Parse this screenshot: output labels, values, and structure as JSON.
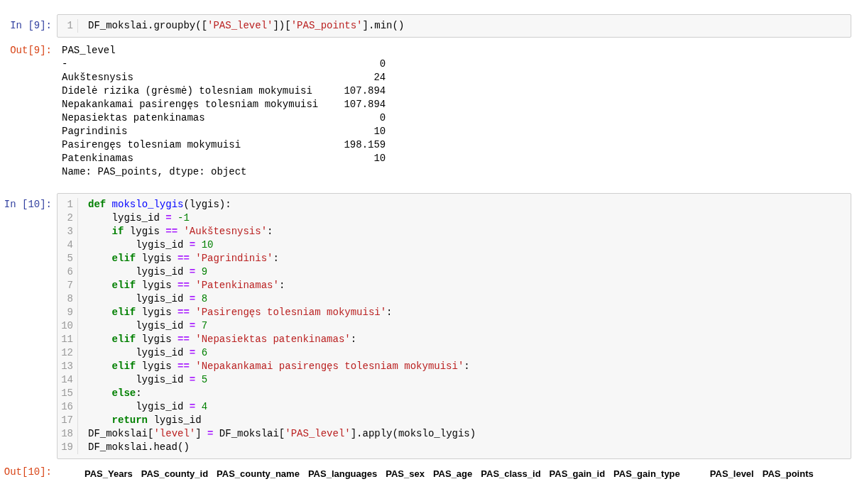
{
  "cells": [
    {
      "kind": "code",
      "prompt": "In [9]:",
      "line_numbers": [
        "1"
      ],
      "lines": [
        [
          {
            "plain": "DF_mokslai.groupby(["
          },
          {
            "str": "'PAS_level'"
          },
          {
            "plain": "])["
          },
          {
            "str": "'PAS_points'"
          },
          {
            "plain": "].min()"
          }
        ]
      ]
    },
    {
      "kind": "series",
      "prompt": "Out[9]:",
      "header": "PAS_level",
      "rows": [
        {
          "label": "-",
          "value": "0"
        },
        {
          "label": "Aukštesnysis",
          "value": "24"
        },
        {
          "label": "Didelė rizika (grėsmė) tolesniam mokymuisi",
          "value": "107.894"
        },
        {
          "label": "Nepakankamai pasirengęs tolesniam mokymuisi",
          "value": "107.894"
        },
        {
          "label": "Nepasiektas patenkinamas",
          "value": "0"
        },
        {
          "label": "Pagrindinis",
          "value": "10"
        },
        {
          "label": "Pasirengęs tolesniam mokymuisi",
          "value": "198.159"
        },
        {
          "label": "Patenkinamas",
          "value": "10"
        }
      ],
      "footer": "Name: PAS_points, dtype: object"
    },
    {
      "kind": "code",
      "prompt": "In [10]:",
      "line_numbers": [
        "1",
        "2",
        "3",
        "4",
        "5",
        "6",
        "7",
        "8",
        "9",
        "10",
        "11",
        "12",
        "13",
        "14",
        "15",
        "16",
        "17",
        "18",
        "19"
      ],
      "lines": [
        [
          {
            "kw": "def"
          },
          {
            "fn": " mokslo_lygis"
          },
          {
            "plain": "(lygis):"
          }
        ],
        [
          {
            "plain": "    lygis_id "
          },
          {
            "op": "="
          },
          {
            "num": " -1"
          }
        ],
        [
          {
            "kw": "    if"
          },
          {
            "plain": " lygis "
          },
          {
            "op": "=="
          },
          {
            "str": " 'Aukštesnysis'"
          },
          {
            "plain": ":"
          }
        ],
        [
          {
            "plain": "        lygis_id "
          },
          {
            "op": "="
          },
          {
            "num": " 10"
          }
        ],
        [
          {
            "kw": "    elif"
          },
          {
            "plain": " lygis "
          },
          {
            "op": "=="
          },
          {
            "str": " 'Pagrindinis'"
          },
          {
            "plain": ":"
          }
        ],
        [
          {
            "plain": "        lygis_id "
          },
          {
            "op": "="
          },
          {
            "num": " 9"
          }
        ],
        [
          {
            "kw": "    elif"
          },
          {
            "plain": " lygis "
          },
          {
            "op": "=="
          },
          {
            "str": " 'Patenkinamas'"
          },
          {
            "plain": ":"
          }
        ],
        [
          {
            "plain": "        lygis_id "
          },
          {
            "op": "="
          },
          {
            "num": " 8"
          }
        ],
        [
          {
            "kw": "    elif"
          },
          {
            "plain": " lygis "
          },
          {
            "op": "=="
          },
          {
            "str": " 'Pasirengęs tolesniam mokymuisi'"
          },
          {
            "plain": ":"
          }
        ],
        [
          {
            "plain": "        lygis_id "
          },
          {
            "op": "="
          },
          {
            "num": " 7"
          }
        ],
        [
          {
            "kw": "    elif"
          },
          {
            "plain": " lygis "
          },
          {
            "op": "=="
          },
          {
            "str": " 'Nepasiektas patenkinamas'"
          },
          {
            "plain": ":"
          }
        ],
        [
          {
            "plain": "        lygis_id "
          },
          {
            "op": "="
          },
          {
            "num": " 6"
          }
        ],
        [
          {
            "kw": "    elif"
          },
          {
            "plain": " lygis "
          },
          {
            "op": "=="
          },
          {
            "str": " 'Nepakankamai pasirengęs tolesniam mokymuisi'"
          },
          {
            "plain": ":"
          }
        ],
        [
          {
            "plain": "        lygis_id "
          },
          {
            "op": "="
          },
          {
            "num": " 5"
          }
        ],
        [
          {
            "kw": "    else"
          },
          {
            "plain": ":"
          }
        ],
        [
          {
            "plain": "        lygis_id "
          },
          {
            "op": "="
          },
          {
            "num": " 4"
          }
        ],
        [
          {
            "kw": "    return"
          },
          {
            "plain": " lygis_id"
          }
        ],
        [
          {
            "plain": "DF_mokslai["
          },
          {
            "str": "'level'"
          },
          {
            "plain": "] "
          },
          {
            "op": "="
          },
          {
            "plain": " DF_mokslai["
          },
          {
            "str": "'PAS_level'"
          },
          {
            "plain": "].apply(mokslo_lygis)"
          }
        ],
        [
          {
            "plain": "DF_mokslai.head()"
          }
        ]
      ]
    },
    {
      "kind": "table",
      "prompt": "Out[10]:",
      "columns": [
        "PAS_Years",
        "PAS_county_id",
        "PAS_county_name",
        "PAS_languages",
        "PAS_sex",
        "PAS_age",
        "PAS_class_id",
        "PAS_gain_id",
        "PAS_gain_type",
        "PAS_level",
        "PAS_points"
      ]
    }
  ]
}
